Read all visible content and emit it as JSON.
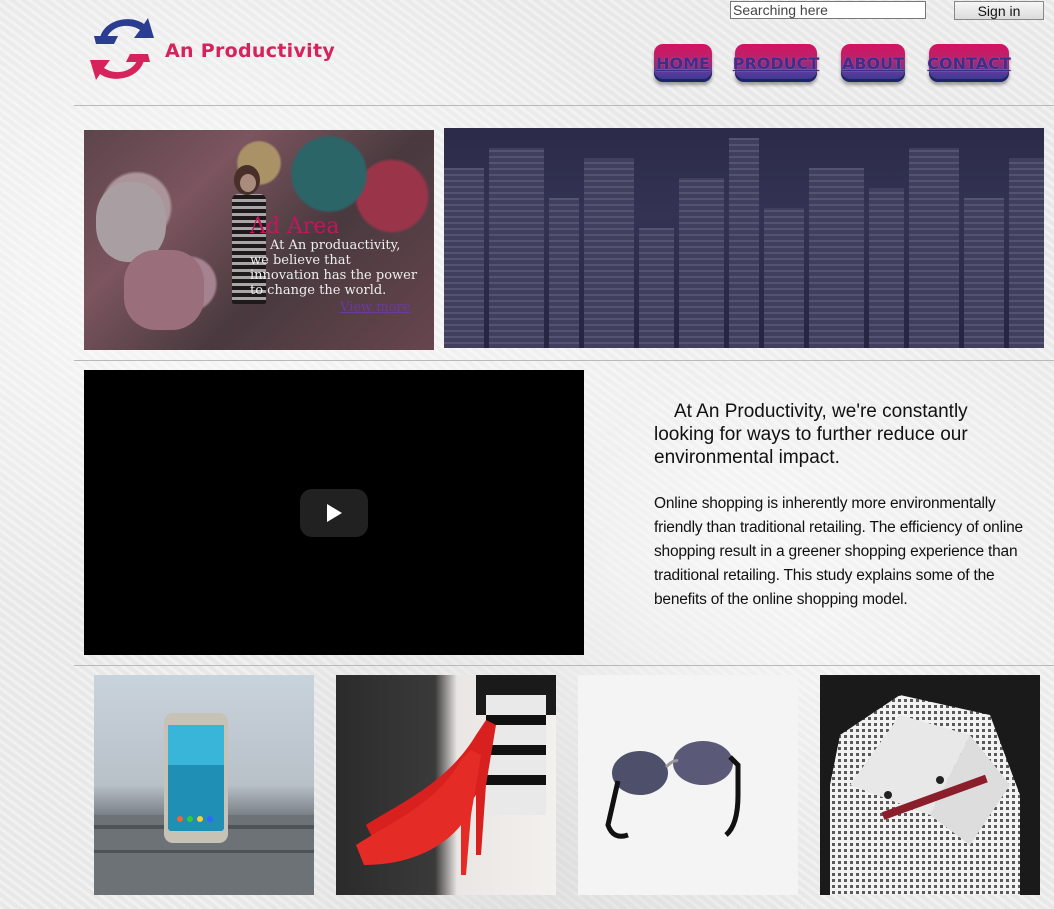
{
  "header": {
    "search_placeholder": "Searching here",
    "signin_label": "Sign in",
    "logo_text": "An Productivity"
  },
  "nav": {
    "items": [
      {
        "label": "HOME"
      },
      {
        "label": "PRODUCT"
      },
      {
        "label": "ABOUT"
      },
      {
        "label": "CONTACT"
      }
    ]
  },
  "ad": {
    "title": "Ad Area",
    "text": "At An produactivity, we believe that innovation has the power to change the world.",
    "link": "View more"
  },
  "video": {
    "play_icon": "play-icon"
  },
  "about": {
    "intro": "At An Productivity, we're constantly looking for ways to further reduce our environmental impact.",
    "body": "Online shopping is inherently more environmentally friendly than traditional retailing. The efficiency of online shopping result in a greener shopping experience than traditional retailing. This study explains some of the benefits of the online shopping model."
  },
  "products": [
    {
      "name": "smartphone-image"
    },
    {
      "name": "red-heels-image"
    },
    {
      "name": "sunglasses-image"
    },
    {
      "name": "shirt-image"
    }
  ],
  "colors": {
    "brand": "#d6235b",
    "nav_gradient_top": "#d4125f",
    "nav_gradient_bottom": "#2f3a8e"
  }
}
